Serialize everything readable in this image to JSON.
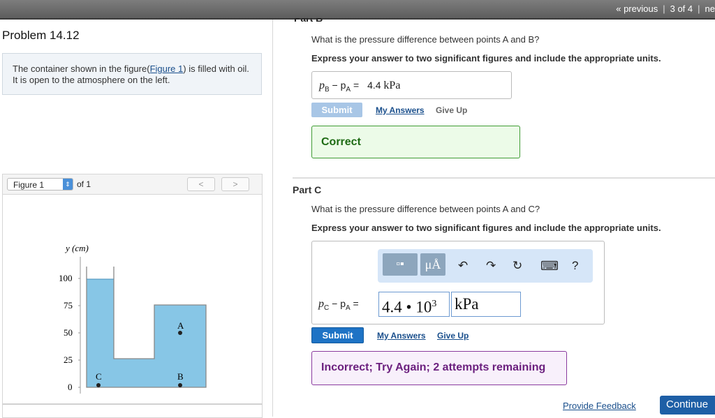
{
  "nav": {
    "previous": "« previous",
    "sep1": "|",
    "page": "3 of 4",
    "sep2": "|",
    "next": "ne"
  },
  "problem": {
    "title": "Problem 14.12",
    "text_before": "The container shown in the figure(",
    "figure_link": "Figure 1",
    "text_after": ") is filled with oil. It is open to the atmosphere on the left."
  },
  "figure": {
    "select_value": "Figure 1",
    "of_label": "of 1",
    "prev": "<",
    "next": ">",
    "axis_label": "y (cm)",
    "ticks": [
      "100",
      "75",
      "50",
      "25",
      "0"
    ],
    "point_labels": {
      "a": "A",
      "b": "B",
      "c": "C"
    },
    "fill_color": "#87c6e6"
  },
  "partB": {
    "header_cut": "Part B",
    "question": "What is the pressure difference between points A and B?",
    "instruction": "Express your answer to two significant figures and include the appropriate units.",
    "eq_label": "p",
    "eq_sub1": "B",
    "eq_minus": " − p",
    "eq_sub2": "A",
    "eq_equals": " =",
    "answer_value": "4.4",
    "answer_unit": "kPa",
    "submit": "Submit",
    "my_answers": "My Answers",
    "give_up": "Give Up",
    "result": "Correct"
  },
  "partC": {
    "title": "Part C",
    "question": "What is the pressure difference between points A and C?",
    "instruction": "Express your answer to two significant figures and include the appropriate units.",
    "toolbar": {
      "template": "▫▪",
      "units": "μÅ",
      "undo": "↶",
      "redo": "↷",
      "reset": "↻",
      "keyboard": "⌨",
      "help": "?"
    },
    "eq_label": "p",
    "eq_sub1": "C",
    "eq_minus": " − p",
    "eq_sub2": "A",
    "eq_equals": " =",
    "value_mantissa": "4.4",
    "value_dot": " • ",
    "value_base": "10",
    "value_exp": "3",
    "unit": "kPa",
    "submit": "Submit",
    "my_answers": "My Answers",
    "give_up": "Give Up",
    "result": "Incorrect; Try Again; 2 attempts remaining"
  },
  "footer": {
    "feedback": "Provide Feedback",
    "continue": "Continue"
  }
}
